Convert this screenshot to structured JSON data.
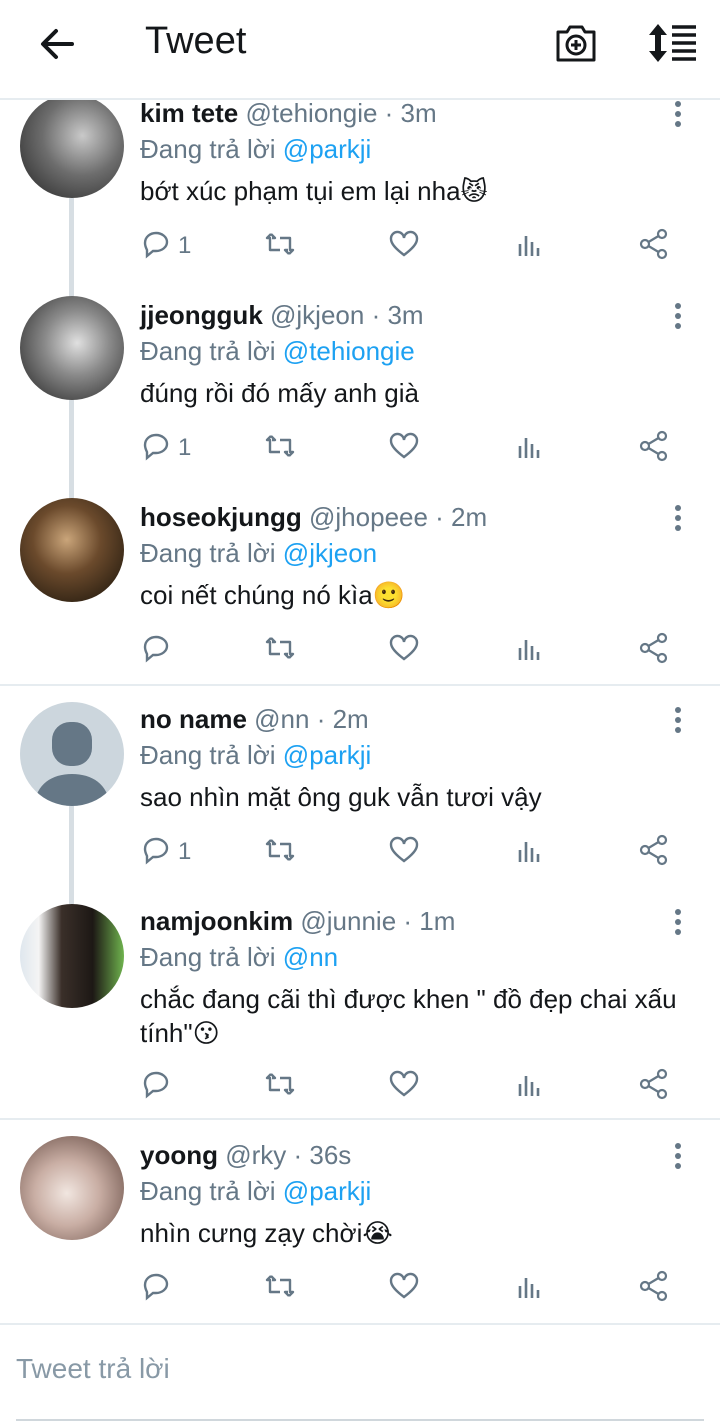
{
  "header": {
    "title": "Tweet",
    "back_icon": "arrow-left-icon",
    "camera_icon": "camera-plus-icon",
    "sort_icon": "sort-icon"
  },
  "replying_label": "Đang trả lời",
  "tweets": [
    {
      "name": "kim tete",
      "handle": "@tehiongie · 3m",
      "reply_to": "@parkji",
      "text": "bớt xúc phạm tụi em lại nha😾",
      "reply_count": "1"
    },
    {
      "name": "jjeongguk",
      "handle": "@jkjeon · 3m",
      "reply_to": "@tehiongie",
      "text": "đúng rồi đó mấy anh già",
      "reply_count": "1"
    },
    {
      "name": "hoseokjungg",
      "handle": "@jhopeee · 2m",
      "reply_to": "@jkjeon",
      "text": "coi nết chúng nó kìa🙂",
      "reply_count": ""
    },
    {
      "name": "no name",
      "handle": "@nn · 2m",
      "reply_to": "@parkji",
      "text": "sao nhìn mặt ông guk vẫn tươi vậy",
      "reply_count": "1"
    },
    {
      "name": "namjoonkim",
      "handle": "@junnie · 1m",
      "reply_to": "@nn",
      "text": "chắc đang cãi thì được khen \" đồ đẹp chai xấu tính\"😗",
      "reply_count": ""
    },
    {
      "name": "yoong",
      "handle": "@rky · 36s",
      "reply_to": "@parkji",
      "text": "nhìn cưng zạy chời😭",
      "reply_count": ""
    }
  ],
  "composer": {
    "placeholder": "Tweet trả lời"
  },
  "colors": {
    "accent": "#1da1f2",
    "secondary": "#657786",
    "divider": "#e6ecf0"
  }
}
